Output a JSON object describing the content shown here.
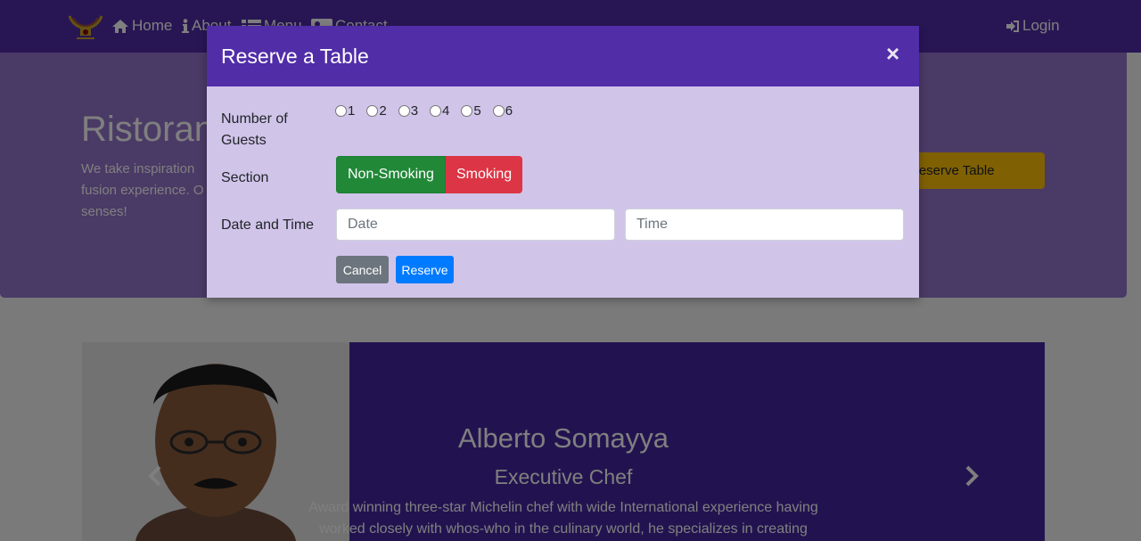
{
  "navbar": {
    "items": [
      {
        "label": "Home",
        "icon": "home-icon"
      },
      {
        "label": "About",
        "icon": "info-icon"
      },
      {
        "label": "Menu",
        "icon": "list-icon"
      },
      {
        "label": "Contact",
        "icon": "address-card-icon"
      }
    ],
    "login_label": "Login",
    "login_icon": "sign-in-icon"
  },
  "jumbotron": {
    "title": "Ristorante con Fusion",
    "text_lines": [
      "We take inspiration",
      "fusion experience. O",
      "senses!"
    ],
    "reserve_button": "Reserve Table"
  },
  "carousel": {
    "name": "Alberto Somayya",
    "role": "Executive Chef",
    "description_lines": [
      "Award winning three-star Michelin chef with wide International experience having",
      "worked closely with whos-who in the culinary world, he specializes in creating"
    ]
  },
  "modal": {
    "title": "Reserve a Table",
    "close_symbol": "×",
    "guests_label_line1": "Number of",
    "guests_label_line2": "Guests",
    "guest_options": [
      "1",
      "2",
      "3",
      "4",
      "5",
      "6"
    ],
    "section_label": "Section",
    "section_options": [
      "Non-Smoking",
      "Smoking"
    ],
    "selected_section": "Non-Smoking",
    "datetime_label": "Date and Time",
    "date_placeholder": "Date",
    "time_placeholder": "Time",
    "cancel_label": "Cancel",
    "reserve_label": "Reserve"
  },
  "colors": {
    "primary": "#512da8",
    "modal_body": "#d1c4e9",
    "jumbotron": "#9575cd",
    "success": "#218838",
    "danger": "#dc3545",
    "secondary": "#6c757d",
    "info": "#007bff",
    "warning": "#ffc107"
  }
}
